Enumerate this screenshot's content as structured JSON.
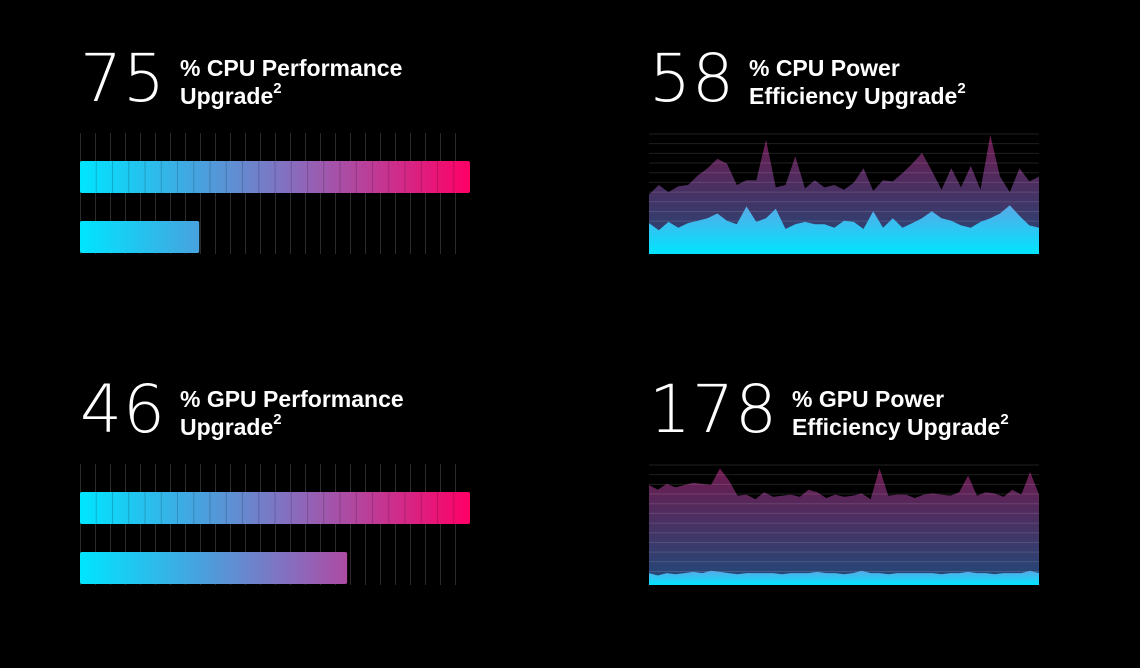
{
  "panels": [
    {
      "big": "75",
      "line1": "% CPU Performance",
      "line2": "Upgrade",
      "sup": "2"
    },
    {
      "big": "58",
      "line1": "% CPU Power",
      "line2": "Efficiency Upgrade",
      "sup": "2"
    },
    {
      "big": "46",
      "line1": "% GPU Performance",
      "line2": "Upgrade",
      "sup": "2"
    },
    {
      "big": "178",
      "line1": "% GPU Power",
      "line2": "Efficiency Upgrade",
      "sup": "2"
    }
  ],
  "colors": {
    "cyan": "#00e5ff",
    "pink": "#ff0066",
    "bg": "#000000"
  },
  "chart_data": [
    {
      "type": "bar",
      "series": [
        {
          "name": "",
          "values": [
            1.75
          ]
        },
        {
          "name": "",
          "values": [
            0.535
          ]
        }
      ],
      "xlim": [
        0,
        1.75
      ],
      "grid": true
    },
    {
      "type": "area",
      "series": [
        {
          "name": "",
          "values": [
            50,
            58,
            52,
            57,
            58,
            66,
            72,
            80,
            76,
            58,
            62,
            62,
            96,
            56,
            58,
            82,
            55,
            62,
            56,
            58,
            54,
            60,
            72,
            53,
            62,
            61,
            68,
            76,
            85,
            70,
            54,
            72,
            56,
            74,
            54,
            100,
            65,
            52,
            72,
            61,
            65
          ]
        },
        {
          "name": "",
          "values": [
            26,
            20,
            27,
            22,
            26,
            28,
            30,
            34,
            28,
            25,
            40,
            27,
            30,
            38,
            21,
            25,
            27,
            25,
            25,
            22,
            28,
            27,
            21,
            36,
            22,
            30,
            22,
            26,
            30,
            36,
            30,
            28,
            24,
            22,
            27,
            30,
            34,
            41,
            32,
            24,
            22
          ]
        }
      ],
      "ylim": [
        0,
        100
      ],
      "grid": true
    },
    {
      "type": "bar",
      "series": [
        {
          "name": "",
          "values": [
            1.46
          ]
        },
        {
          "name": "",
          "values": [
            1.0
          ]
        }
      ],
      "xlim": [
        0,
        1.46
      ],
      "grid": true
    },
    {
      "type": "area",
      "series": [
        {
          "name": "",
          "values": [
            84,
            80,
            85,
            82,
            84,
            86,
            85,
            84,
            98,
            88,
            75,
            76,
            72,
            78,
            74,
            75,
            76,
            74,
            80,
            78,
            73,
            76,
            74,
            75,
            77,
            72,
            98,
            75,
            76,
            76,
            73,
            76,
            77,
            76,
            75,
            78,
            92,
            75,
            78,
            77,
            74,
            80,
            76,
            95,
            76
          ]
        },
        {
          "name": "",
          "values": [
            10,
            8,
            10,
            9,
            10,
            11,
            10,
            12,
            11,
            10,
            9,
            10,
            10,
            10,
            10,
            9,
            10,
            10,
            10,
            11,
            10,
            10,
            9,
            10,
            12,
            10,
            10,
            9,
            10,
            10,
            10,
            10,
            10,
            9,
            10,
            10,
            11,
            10,
            10,
            9,
            10,
            10,
            10,
            12,
            10
          ]
        }
      ],
      "ylim": [
        0,
        100
      ],
      "grid": true
    }
  ]
}
